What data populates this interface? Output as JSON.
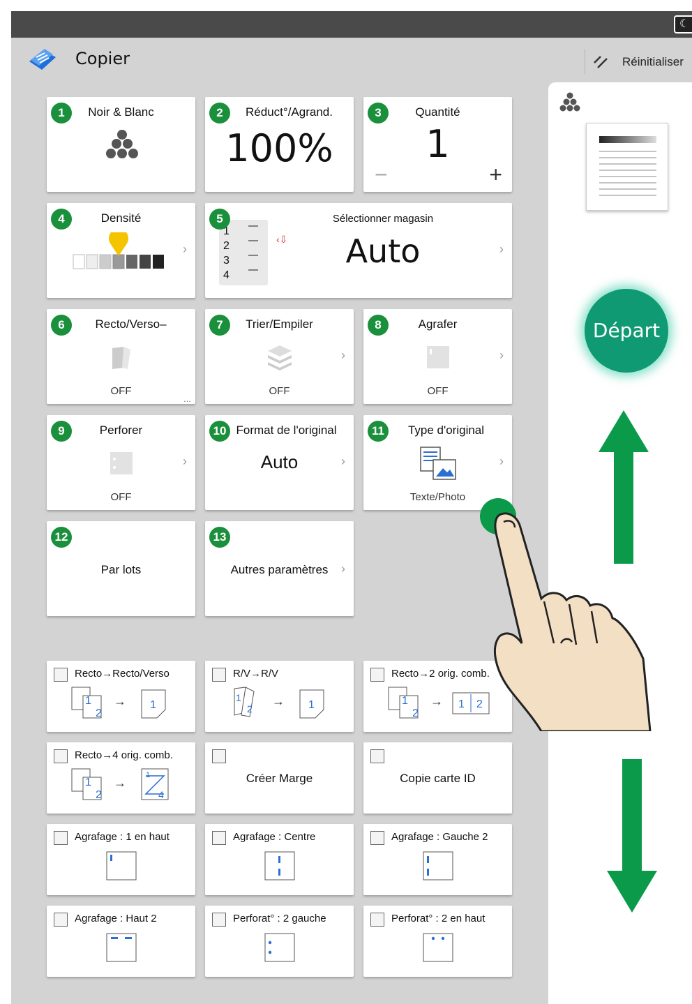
{
  "app": {
    "title": "Copier",
    "reset_label": "Réinitialiser"
  },
  "tiles": {
    "t1": {
      "num": "1",
      "title": "Noir & Blanc"
    },
    "t2": {
      "num": "2",
      "title": "Réduct°/Agrand.",
      "value": "100%"
    },
    "t3": {
      "num": "3",
      "title": "Quantité",
      "value": "1",
      "minus": "−",
      "plus": "+"
    },
    "t4": {
      "num": "4",
      "title": "Densité",
      "level": 4,
      "steps": 7
    },
    "t5": {
      "num": "5",
      "title": "Sélectionner magasin",
      "value": "Auto",
      "trays": [
        "1",
        "2",
        "3",
        "4"
      ]
    },
    "t6": {
      "num": "6",
      "title": "Recto/Verso–",
      "state": "OFF",
      "more": "..."
    },
    "t7": {
      "num": "7",
      "title": "Trier/Empiler",
      "state": "OFF"
    },
    "t8": {
      "num": "8",
      "title": "Agrafer",
      "state": "OFF"
    },
    "t9": {
      "num": "9",
      "title": "Perforer",
      "state": "OFF"
    },
    "t10": {
      "num": "10",
      "title": "Format de l'original",
      "value": "Auto"
    },
    "t11": {
      "num": "11",
      "title": "Type d'original",
      "value": "Texte/Photo"
    },
    "t12": {
      "num": "12",
      "title": "Par lots"
    },
    "t13": {
      "num": "13",
      "title": "Autres paramètres"
    }
  },
  "shortcuts": {
    "s1": "Recto→Recto/Verso",
    "s2": "R/V→R/V",
    "s3": "Recto→2 orig. comb.",
    "s4": "Recto→4 orig. comb.",
    "s5": "Créer Marge",
    "s6": "Copie carte ID",
    "s7": "Agrafage : 1 en haut",
    "s8": "Agrafage : Centre",
    "s9": "Agrafage : Gauche 2",
    "s10": "Agrafage : Haut 2",
    "s11": "Perforat° : 2 gauche",
    "s12": "Perforat° : 2 en haut"
  },
  "illu_text": {
    "one": "1",
    "two": "2",
    "arrow": "→",
    "four": "4"
  },
  "panel": {
    "start_label": "Départ"
  },
  "colors": {
    "accent_green": "#1a8f3c",
    "start_button": "#0f9a73",
    "arrow_green": "#0b9a4a",
    "bulb_yellow": "#f5c400"
  }
}
